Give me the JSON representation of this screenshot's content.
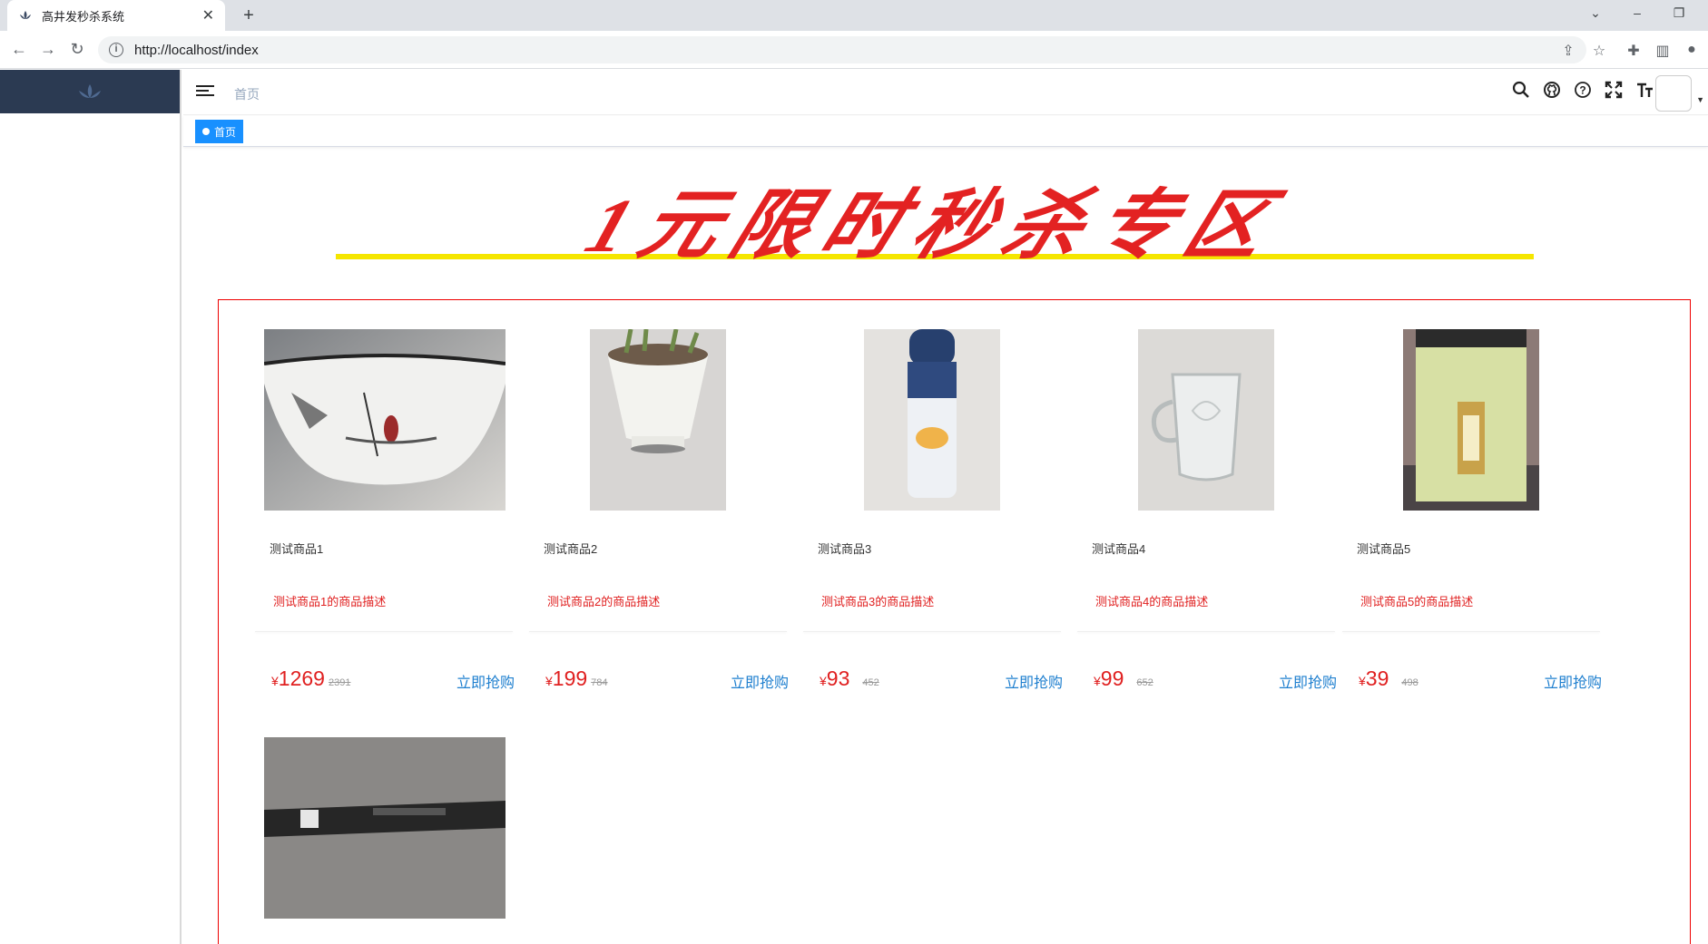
{
  "browser": {
    "tab_title": "高井发秒杀系统",
    "url": "http://localhost/index"
  },
  "app": {
    "breadcrumb": "首页",
    "active_tag": "首页",
    "banner_title": "1元限时秒杀专区"
  },
  "products": [
    {
      "name": "测试商品1",
      "desc": "测试商品1的商品描述",
      "price": "1269",
      "orig_price": "2391",
      "buy_label": "立即抢购",
      "currency": "¥"
    },
    {
      "name": "测试商品2",
      "desc": "测试商品2的商品描述",
      "price": "199",
      "orig_price": "784",
      "buy_label": "立即抢购",
      "currency": "¥"
    },
    {
      "name": "测试商品3",
      "desc": "测试商品3的商品描述",
      "price": "93",
      "orig_price": "452",
      "buy_label": "立即抢购",
      "currency": "¥"
    },
    {
      "name": "测试商品4",
      "desc": "测试商品4的商品描述",
      "price": "99",
      "orig_price": "652",
      "buy_label": "立即抢购",
      "currency": "¥"
    },
    {
      "name": "测试商品5",
      "desc": "测试商品5的商品描述",
      "price": "39",
      "orig_price": "498",
      "buy_label": "立即抢购",
      "currency": "¥"
    }
  ],
  "icons": {
    "search": "search-icon",
    "github": "github-icon",
    "help": "question-icon",
    "fullscreen": "fullscreen-icon",
    "font_size": "font-size-icon"
  },
  "colors": {
    "accent": "#1890ff",
    "price_red": "#e02020",
    "buy_blue": "#1e7fcf",
    "sidebar_dark": "#2b3a52",
    "banner_red": "#e32222",
    "banner_yellow": "#f5e600"
  }
}
